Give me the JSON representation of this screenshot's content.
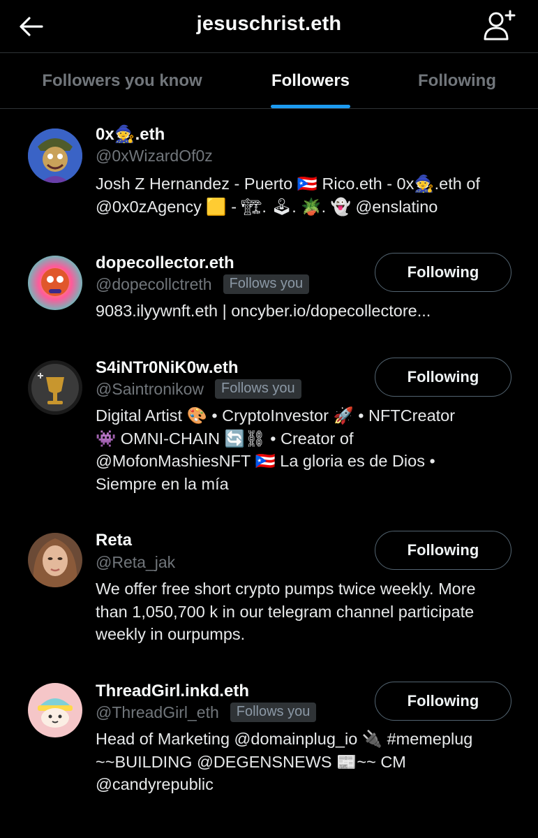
{
  "header": {
    "title": "jesuschrist.eth",
    "back_icon": "arrow-left-icon",
    "follow_icon": "person-add-icon"
  },
  "tabs": [
    {
      "label": "Followers you know"
    },
    {
      "label": "Followers",
      "active": true
    },
    {
      "label": "Following"
    }
  ],
  "accent_color": "#1d9bf0",
  "users": [
    {
      "name": "0x🧙.eth",
      "handle": "@0xWizardOf0z",
      "follows_you": "",
      "button": "",
      "bio": [
        "Josh Z Hernandez - Puerto 🇵🇷 Rico.eth - 0x🧙.eth of",
        "@0x0zAgency 🟨 - 🏗. 🕹. 🪴. 👻 @enslatino"
      ]
    },
    {
      "name": "dopecollector.eth",
      "handle": "@dopecollctreth",
      "follows_you": "Follows you",
      "button": "Following",
      "bio": [
        "9083.ilyywnft.eth | oncyber.io/dopecollectore..."
      ]
    },
    {
      "name": "S4iNTr0NiK0w.eth",
      "handle": "@Saintronikow",
      "follows_you": "Follows you",
      "button": "Following",
      "bio": [
        "Digital Artist 🎨 • CryptoInvestor 🚀 • NFTCreator",
        "👾 OMNI-CHAIN 🔄⛓ • Creator of",
        "@MofonMashiesNFT 🇵🇷 La gloria es de Dios •",
        "Siempre en la mía"
      ]
    },
    {
      "name": "Reta",
      "handle": "@Reta_jak",
      "follows_you": "",
      "button": "Following",
      "bio": [
        "We offer free short crypto pumps twice weekly. More",
        "than 1,050,700 k in our telegram channel participate",
        "weekly in ourpumps."
      ]
    },
    {
      "name": "ThreadGirl.inkd.eth",
      "handle": "@ThreadGirl_eth",
      "follows_you": "Follows you",
      "button": "Following",
      "bio": [
        "Head of Marketing @domainplug_io 🔌 #memeplug",
        "~~BUILDING @DEGENSNEWS 📰~~ CM",
        "@candyrepublic"
      ]
    }
  ]
}
